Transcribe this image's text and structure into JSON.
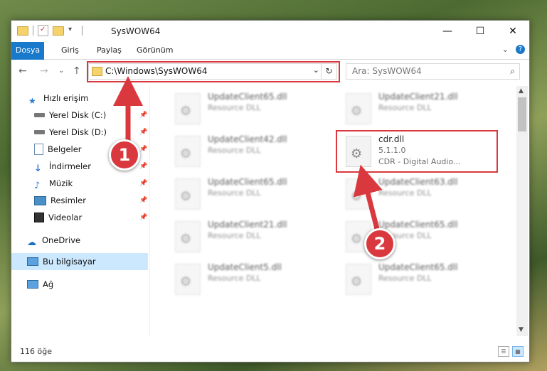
{
  "window": {
    "title": "SysWOW64",
    "buttons": {
      "minimize": "—",
      "maximize": "☐",
      "close": "✕"
    }
  },
  "ribbon": {
    "tabs": [
      "Dosya",
      "Giriş",
      "Paylaş",
      "Görünüm"
    ],
    "collapse": "⌄",
    "help": "?"
  },
  "nav": {
    "back": "←",
    "forward": "→",
    "recent": "⌄",
    "up": "↑",
    "address": "C:\\Windows\\SysWOW64",
    "address_drop": "⌄",
    "refresh": "↻",
    "search_placeholder": "Ara: SysWOW64",
    "search_icon": "⌕"
  },
  "sidebar": {
    "items": [
      {
        "label": "Hızlı erişim",
        "icon": "star-icon",
        "pinned": false
      },
      {
        "label": "Yerel Disk (C:)",
        "icon": "drive-icon",
        "pinned": true
      },
      {
        "label": "Yerel Disk (D:)",
        "icon": "drive-icon",
        "pinned": true
      },
      {
        "label": "Belgeler",
        "icon": "documents-icon",
        "pinned": true
      },
      {
        "label": "İndirmeler",
        "icon": "download-icon",
        "pinned": true
      },
      {
        "label": "Müzik",
        "icon": "music-icon",
        "pinned": true
      },
      {
        "label": "Resimler",
        "icon": "pictures-icon",
        "pinned": true
      },
      {
        "label": "Videolar",
        "icon": "videos-icon",
        "pinned": true
      },
      {
        "label": "OneDrive",
        "icon": "onedrive-icon",
        "pinned": false
      },
      {
        "label": "Bu bilgisayar",
        "icon": "computer-icon",
        "pinned": false
      },
      {
        "label": "Ağ",
        "icon": "network-icon",
        "pinned": false
      }
    ],
    "pin_glyph": "📌"
  },
  "files": {
    "left": [
      {
        "name": "UpdateClient65.dll",
        "desc": "Resource DLL"
      },
      {
        "name": "UpdateClient42.dll",
        "desc": "Resource DLL"
      },
      {
        "name": "UpdateClient65.dll",
        "desc": "Resource DLL"
      },
      {
        "name": "UpdateClient21.dll",
        "desc": "Resource DLL"
      },
      {
        "name": "UpdateClient5.dll",
        "desc": "Resource DLL"
      }
    ],
    "right": [
      {
        "name": "UpdateClient21.dll",
        "desc": "Resource DLL"
      },
      {
        "name": "cdr.dll",
        "version": "5.1.1.0",
        "desc": "CDR - Digital Audio..."
      },
      {
        "name": "UpdateClient63.dll",
        "desc": "Resource DLL"
      },
      {
        "name": "UpdateClient65.dll",
        "desc": "Resource DLL"
      },
      {
        "name": "UpdateClient65.dll",
        "desc": "Resource DLL"
      }
    ]
  },
  "status": {
    "count": "116 öğe"
  },
  "annotations": {
    "marker1": "1",
    "marker2": "2",
    "color": "#d9393e"
  }
}
